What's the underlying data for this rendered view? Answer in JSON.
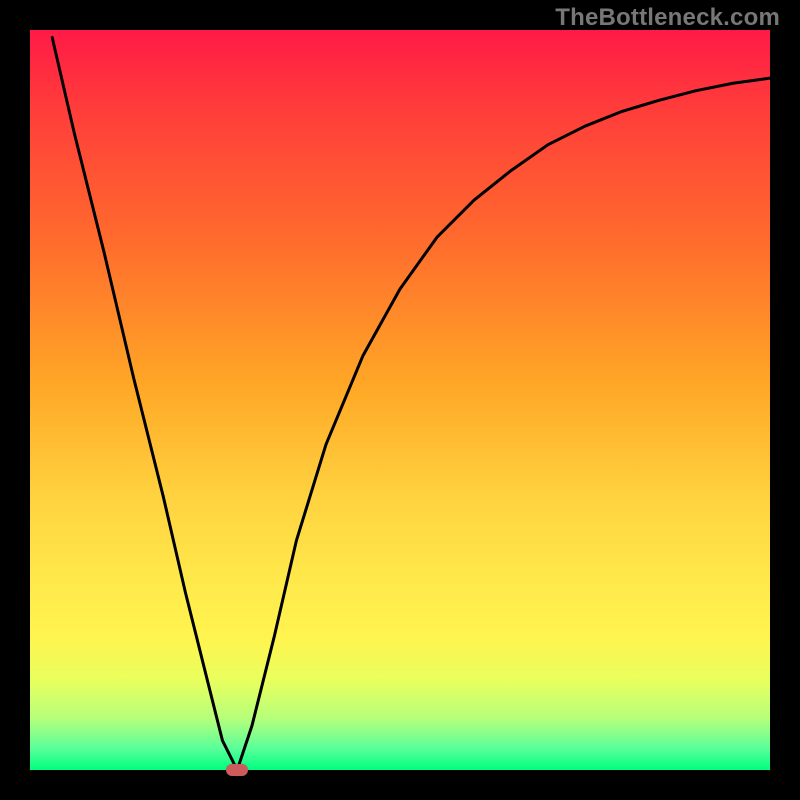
{
  "watermark": "TheBottleneck.com",
  "colors": {
    "frame": "#000000",
    "curve": "#000000",
    "marker": "#cc5c5c",
    "gradient_stops": [
      "#ff1a46",
      "#ff3b3b",
      "#ff6a2d",
      "#ffa726",
      "#ffd23f",
      "#ffe84a",
      "#fff44f",
      "#e8ff5e",
      "#b6ff7a",
      "#5cff9a",
      "#00ff7f"
    ]
  },
  "chart_data": {
    "type": "line",
    "title": "",
    "xlabel": "",
    "ylabel": "",
    "xlim": [
      0,
      100
    ],
    "ylim": [
      0,
      100
    ],
    "grid": false,
    "legend": false,
    "series": [
      {
        "name": "curve",
        "x": [
          3,
          6,
          10,
          14,
          18,
          21,
          24,
          26,
          28,
          30,
          33,
          36,
          40,
          45,
          50,
          55,
          60,
          65,
          70,
          75,
          80,
          85,
          90,
          95,
          100
        ],
        "y": [
          99,
          86,
          70,
          53,
          37,
          24,
          12,
          4,
          0,
          6,
          18,
          31,
          44,
          56,
          65,
          72,
          77,
          81,
          84.5,
          87,
          89,
          90.5,
          91.8,
          92.8,
          93.5
        ]
      }
    ],
    "marker": {
      "x": 28,
      "y": 0
    },
    "background": "vertical-gradient-red-to-green"
  }
}
